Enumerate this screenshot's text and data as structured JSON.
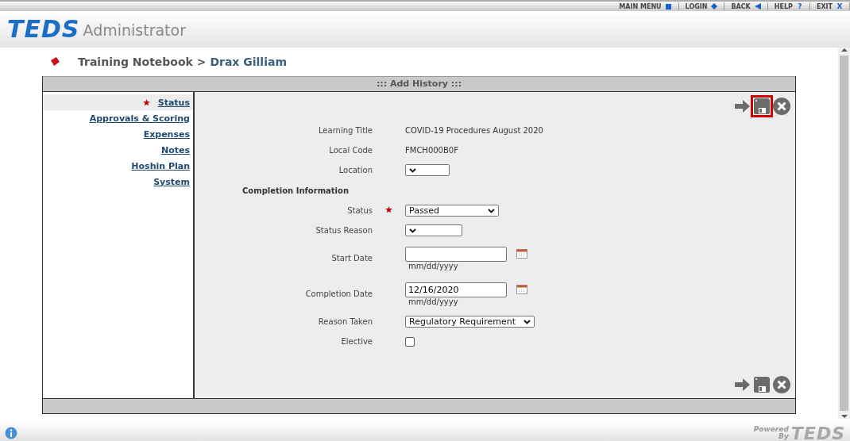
{
  "nav": [
    {
      "label": "MAIN MENU"
    },
    {
      "label": "LOGIN"
    },
    {
      "label": "BACK"
    },
    {
      "label": "HELP",
      "glyph": "?"
    },
    {
      "label": "EXIT",
      "glyph": "X"
    }
  ],
  "logo": {
    "brand": "TEDS",
    "title": "Administrator"
  },
  "breadcrumb": {
    "section": "Training Notebook",
    "separator": ">",
    "name": "Drax Gilliam"
  },
  "panel_title": "::: Add History :::",
  "sidebar": [
    {
      "label": "Status",
      "selected": true,
      "required": true
    },
    {
      "label": "Approvals & Scoring",
      "selected": false,
      "required": false
    },
    {
      "label": "Expenses",
      "selected": false,
      "required": false
    },
    {
      "label": "Notes",
      "selected": false,
      "required": false
    },
    {
      "label": "Hoshin Plan",
      "selected": false,
      "required": false
    },
    {
      "label": "System",
      "selected": false,
      "required": false
    }
  ],
  "toolbars": [
    {
      "save_highlighted": true
    },
    {
      "save_highlighted": false
    }
  ],
  "fields": [
    {
      "kind": "text",
      "label": "Learning Title",
      "value": "COVID-19 Procedures August 2020"
    },
    {
      "kind": "text",
      "label": "Local Code",
      "value": "FMCH000B0F"
    },
    {
      "kind": "select",
      "label": "Location"
    },
    {
      "kind": "heading",
      "label": "Completion Information"
    },
    {
      "kind": "select",
      "label": "Status",
      "value": "Passed",
      "required": true
    },
    {
      "kind": "select",
      "label": "Status Reason"
    },
    {
      "kind": "date",
      "label": "Start Date",
      "hint": "mm/dd/yyyy"
    },
    {
      "kind": "date",
      "label": "Completion Date",
      "value": "12/16/2020",
      "hint": "mm/dd/yyyy"
    },
    {
      "kind": "select",
      "label": "Reason Taken",
      "value": "Regulatory Requirement"
    },
    {
      "kind": "checkbox",
      "label": "Elective",
      "checked": false
    }
  ],
  "footer": {
    "powered": "Powered",
    "by": "By",
    "brand": "TEDS"
  }
}
